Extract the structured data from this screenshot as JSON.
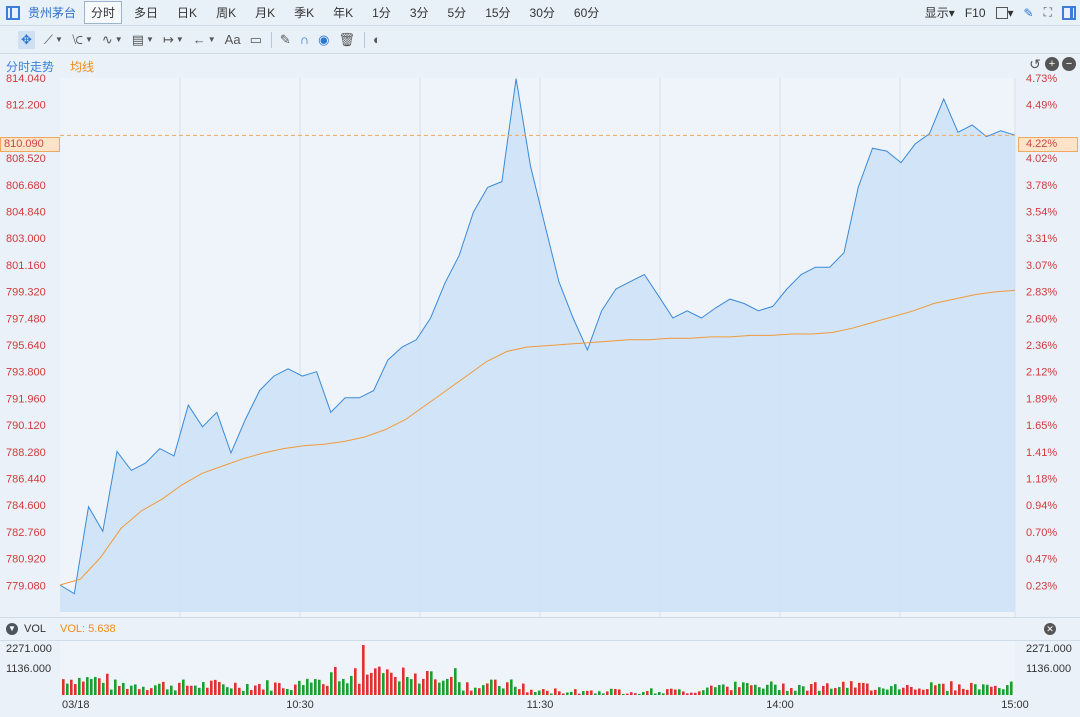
{
  "header": {
    "stock_name": "贵州茅台",
    "tabs": [
      "分时",
      "多日",
      "日K",
      "周K",
      "月K",
      "季K",
      "年K",
      "1分",
      "3分",
      "5分",
      "15分",
      "30分",
      "60分"
    ],
    "active_tab": 0,
    "display_label": "显示",
    "f10_label": "F10"
  },
  "toolbar": {
    "font_label": "Aa"
  },
  "legend": {
    "price_label": "分时走势",
    "avg_label": "均线"
  },
  "axis": {
    "left_labels": [
      "814.040",
      "812.200",
      "808.520",
      "806.680",
      "804.840",
      "803.000",
      "801.160",
      "799.320",
      "797.480",
      "795.640",
      "793.800",
      "791.960",
      "790.120",
      "788.280",
      "786.440",
      "784.600",
      "782.760",
      "780.920",
      "779.080"
    ],
    "right_labels": [
      "4.73%",
      "4.49%",
      "4.02%",
      "3.78%",
      "3.54%",
      "3.31%",
      "3.07%",
      "2.83%",
      "2.60%",
      "2.36%",
      "2.12%",
      "1.89%",
      "1.65%",
      "1.41%",
      "1.18%",
      "0.94%",
      "0.70%",
      "0.47%",
      "0.23%"
    ],
    "current_price": "810.090",
    "current_pct": "4.22%",
    "time_labels": [
      "03/18",
      "10:30",
      "11:30",
      "14:00",
      "15:00"
    ]
  },
  "volume": {
    "label": "VOL",
    "value_label": "VOL: 5.638",
    "left_ticks": [
      "2271.000",
      "1136.000"
    ],
    "right_ticks": [
      "2271.000",
      "1136.000"
    ]
  },
  "colors": {
    "price_line": "#3a8ad8",
    "price_fill": "#cde0f6",
    "avg_line": "#f09a3a",
    "up": "#e03030",
    "down": "#1aa030",
    "axis_red": "#d23a3a"
  },
  "chart_data": {
    "type": "line",
    "x_range": [
      "09:30",
      "15:00"
    ],
    "ylim": [
      777.24,
      814.04
    ],
    "price": [
      779.1,
      778.5,
      784.5,
      782.8,
      788.3,
      787.0,
      787.5,
      788.5,
      788.0,
      791.5,
      790.0,
      791.0,
      788.2,
      790.5,
      792.5,
      793.5,
      794.0,
      793.5,
      793.8,
      791.0,
      792.0,
      792.0,
      792.5,
      794.6,
      795.5,
      796.0,
      797.5,
      799.9,
      801.8,
      804.8,
      806.5,
      806.9,
      814.0,
      808.0,
      804.0,
      800.0,
      797.5,
      795.3,
      798.0,
      799.5,
      800.0,
      800.5,
      799.0,
      797.5,
      798.0,
      797.5,
      798.2,
      798.8,
      798.5,
      798.0,
      798.3,
      799.5,
      800.5,
      801.0,
      801.0,
      802.0,
      806.5,
      809.2,
      809.0,
      808.2,
      809.5,
      810.2,
      812.6,
      810.3,
      810.8,
      810.0,
      810.4,
      810.1
    ],
    "avg": [
      779.1,
      779.5,
      781.0,
      783.0,
      784.2,
      785.0,
      786.0,
      786.8,
      787.3,
      787.8,
      788.2,
      788.5,
      788.7,
      788.8,
      789.0,
      789.3,
      789.8,
      790.5,
      791.5,
      792.5,
      793.5,
      794.5,
      795.2,
      795.5,
      795.6,
      795.7,
      795.8,
      795.9,
      796.0,
      796.0,
      796.1,
      796.1,
      796.2,
      796.2,
      796.3,
      796.3,
      796.4,
      796.4,
      796.5,
      796.8,
      797.2,
      797.6,
      798.0,
      798.5,
      798.8,
      799.1,
      799.3,
      799.4
    ]
  }
}
